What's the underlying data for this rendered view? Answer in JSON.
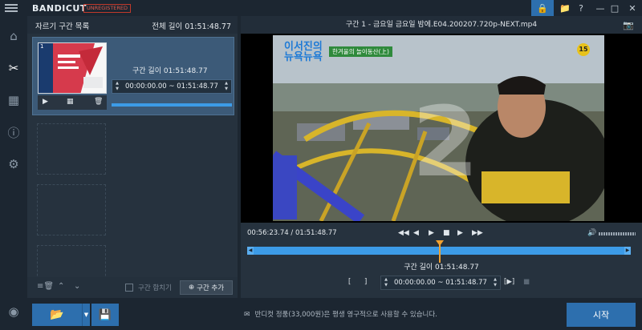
{
  "app": {
    "logo": "BANDICUT",
    "badge": "UNREGISTERED"
  },
  "titlebar": {
    "buttons": [
      "lock-icon",
      "folder-icon",
      "help-icon",
      "minimize-icon",
      "maximize-icon",
      "close-icon"
    ]
  },
  "rail": {
    "items": [
      "home-icon",
      "cut-icon",
      "join-icon",
      "info-icon",
      "settings-icon",
      "record-icon"
    ]
  },
  "segments": {
    "header_title": "자르기 구간 목록",
    "total_length": "전체 길이 01:51:48.77",
    "items": [
      {
        "index": "1",
        "length_label": "구간 길이 01:51:48.77",
        "range": "00:00:00.00 ~ 01:51:48.77"
      }
    ],
    "split_label": "구간 합치기",
    "add_label": "구간 추가"
  },
  "video": {
    "title": "구간 1 - 금요일 금요일 밤에.E04.200207.720p-NEXT.mp4",
    "position": "00:56:23.74 / 01:51:48.77",
    "playhead_fraction": 0.5,
    "segment_length": "구간 길이 01:51:48.77",
    "range": "00:00:00.00 ~ 01:51:48.77",
    "overlay_logo_top": "이서진의",
    "overlay_logo_bottom": "뉴욕뉴욕",
    "overlay_tag": "한겨울의 놀이동산(上)",
    "overlay_rating": "15",
    "overlay_number": "2"
  },
  "bottom": {
    "notice": "반디컷 정품(33,000원)은 평생 영구적으로 사용할 수 있습니다.",
    "start_label": "시작"
  },
  "colors": {
    "accent": "#2d6fae",
    "timeline": "#3c9be7",
    "playhead": "#f0a030",
    "overlay_tag": "#2f8a3c"
  }
}
